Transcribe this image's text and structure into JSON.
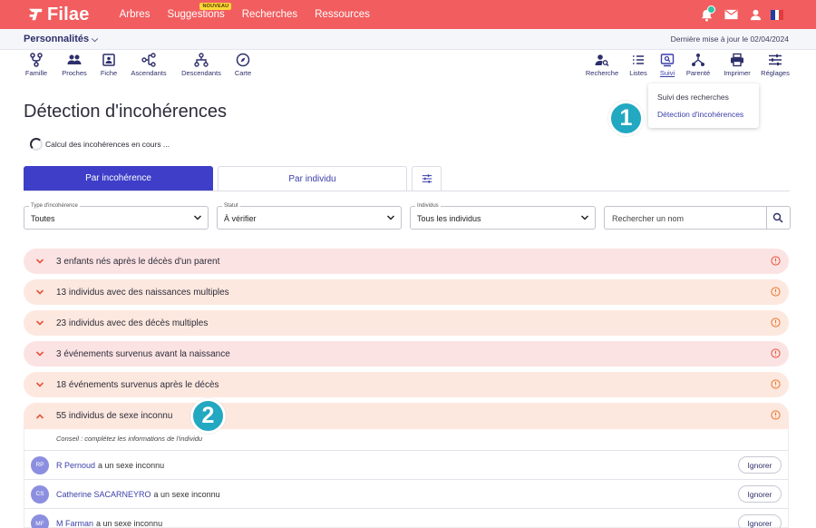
{
  "app": {
    "brand": "Filae",
    "brand_color": "#f25d5f",
    "accent": "#3e3ec8"
  },
  "nav": {
    "items": [
      {
        "label": "Arbres"
      },
      {
        "label": "Suggestions",
        "badge": "NOUVEAU"
      },
      {
        "label": "Recherches"
      },
      {
        "label": "Ressources"
      }
    ],
    "icons": [
      "bell-icon",
      "mail-icon",
      "user-icon",
      "french-flag-icon"
    ]
  },
  "subbar": {
    "selector": "Personnalités",
    "updated": "Dernière mise à jour le 02/04/2024"
  },
  "tools_left": [
    {
      "label": "Famille",
      "icon": "family-icon"
    },
    {
      "label": "Proches",
      "icon": "relatives-icon"
    },
    {
      "label": "Fiche",
      "icon": "card-icon"
    },
    {
      "label": "Ascendants",
      "icon": "ancestors-icon"
    },
    {
      "label": "Descendants",
      "icon": "descendants-icon"
    },
    {
      "label": "Carte",
      "icon": "compass-icon"
    }
  ],
  "tools_right": [
    {
      "label": "Recherche",
      "icon": "person-search-icon"
    },
    {
      "label": "Listes",
      "icon": "list-icon"
    },
    {
      "label": "Suivi",
      "icon": "monitor-search-icon"
    },
    {
      "label": "Parenté",
      "icon": "relationship-icon"
    },
    {
      "label": "Imprimer",
      "icon": "printer-icon"
    },
    {
      "label": "Réglages",
      "icon": "sliders-icon"
    }
  ],
  "dropdown": {
    "item1": "Suivi des recherches",
    "item2": "Détection d'incohérences"
  },
  "callouts": {
    "one": "1",
    "two": "2"
  },
  "page": {
    "title": "Détection d'incohérences",
    "loading": "Calcul des incohérences en cours ..."
  },
  "tabs": {
    "by_issue": "Par incohérence",
    "by_person": "Par individu"
  },
  "filters": {
    "type": {
      "label": "Type d'incohérence",
      "value": "Toutes"
    },
    "status": {
      "label": "Statut",
      "value": "À vérifier"
    },
    "people": {
      "label": "Individus",
      "value": "Tous les individus"
    },
    "search_placeholder": "Rechercher un nom"
  },
  "issues": [
    "3 enfants nés après le décès d'un parent",
    "13 individus avec des naissances multiples",
    "23 individus avec des décès multiples",
    "3 événements survenus avant la naissance",
    "18 événements survenus après le décès",
    "55 individus de sexe inconnu"
  ],
  "open_group": {
    "advice": "Conseil : complétez les informations de l'individu",
    "rows": [
      {
        "initials": "RP",
        "name": "R Pernoud",
        "suffix": "a un sexe inconnu",
        "action": "Ignorer"
      },
      {
        "initials": "CS",
        "name": "Catherine SACARNEYRO",
        "suffix": "a un sexe inconnu",
        "action": "Ignorer"
      },
      {
        "initials": "MF",
        "name": "M Farman",
        "suffix": "a un sexe inconnu",
        "action": "Ignorer"
      }
    ]
  }
}
